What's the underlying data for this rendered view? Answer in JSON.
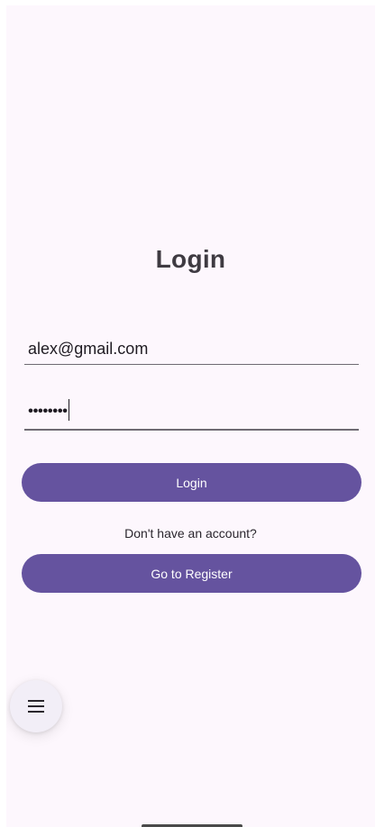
{
  "login": {
    "title": "Login",
    "email_value": "alex@gmail.com",
    "password_value": "••••••••",
    "login_button": "Login",
    "no_account_prompt": "Don't have an account?",
    "register_button": "Go to Register"
  },
  "fab": {
    "icon": "menu-icon"
  },
  "colors": {
    "background": "#fdf7fd",
    "primary": "#65539f",
    "field_underline": "#6f6b73",
    "title_text": "#3f3b42",
    "fab_background": "#f2eef7"
  }
}
